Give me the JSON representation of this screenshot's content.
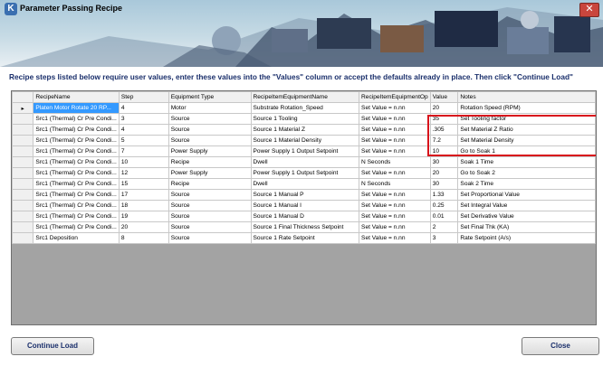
{
  "window": {
    "title": "Parameter Passing Recipe",
    "close_glyph": "✕"
  },
  "instruction": "Recipe steps listed below require user values, enter these values into the \"Values\" column or accept the defaults already in place. Then click \"Continue Load\"",
  "grid": {
    "columns": [
      "RecipeName",
      "Step",
      "Equipment Type",
      "RecipeItemEquipmentName",
      "RecipeItemEquipmentOp",
      "Value",
      "Notes"
    ],
    "selected_row": 0,
    "row_indicator": "▸",
    "rows": [
      [
        "Platen Motor Rotate 20 RP...",
        "4",
        "Motor",
        "Substrate Rotation_Speed",
        "Set Value = n.nn",
        "20",
        "Rotation Speed (RPM)"
      ],
      [
        "Src1 (Thermal) Cr Pre Condi...",
        "3",
        "Source",
        "Source 1 Tooling",
        "Set Value = n.nn",
        "35",
        "Set Tooling factor"
      ],
      [
        "Src1 (Thermal) Cr Pre Condi...",
        "4",
        "Source",
        "Source 1 Material Z",
        "Set Value = n.nn",
        ".305",
        "Set Material Z Ratio"
      ],
      [
        "Src1 (Thermal) Cr Pre Condi...",
        "5",
        "Source",
        "Source 1 Material Density",
        "Set Value = n.nn",
        "7.2",
        "Set Material Density"
      ],
      [
        "Src1 (Thermal) Cr Pre Condi...",
        "7",
        "Power Supply",
        "Power Supply 1 Output Setpoint",
        "Set Value = n.nn",
        "10",
        "Go to Soak 1"
      ],
      [
        "Src1 (Thermal) Cr Pre Condi...",
        "10",
        "Recipe",
        "Dwell",
        "N Seconds",
        "30",
        "Soak 1 Time"
      ],
      [
        "Src1 (Thermal) Cr Pre Condi...",
        "12",
        "Power Supply",
        "Power Supply 1 Output Setpoint",
        "Set Value = n.nn",
        "20",
        "Go to Soak 2"
      ],
      [
        "Src1 (Thermal) Cr Pre Condi...",
        "15",
        "Recipe",
        "Dwell",
        "N Seconds",
        "30",
        "Soak 2 Time"
      ],
      [
        "Src1 (Thermal) Cr Pre Condi...",
        "17",
        "Source",
        "Source 1 Manual P",
        "Set Value = n.nn",
        "1.33",
        "Set Proportional Value"
      ],
      [
        "Src1 (Thermal) Cr Pre Condi...",
        "18",
        "Source",
        "Source 1 Manual I",
        "Set Value = n.nn",
        "0.25",
        "Set Integral Value"
      ],
      [
        "Src1 (Thermal) Cr Pre Condi...",
        "19",
        "Source",
        "Source 1 Manual D",
        "Set Value = n.nn",
        "0.01",
        "Set Derivative Value"
      ],
      [
        "Src1 (Thermal) Cr Pre Condi...",
        "20",
        "Source",
        "Source 1 Final Thickness Setpoint",
        "Set Value = n.nn",
        "2",
        "Set Final Thk (KA)"
      ],
      [
        "Src1 Deposition",
        "8",
        "Source",
        "Source 1 Rate Setpoint",
        "Set Value = n.nn",
        "3",
        "Rate Setpoint (A/s)"
      ]
    ]
  },
  "buttons": {
    "continue_load": "Continue Load",
    "close": "Close"
  }
}
